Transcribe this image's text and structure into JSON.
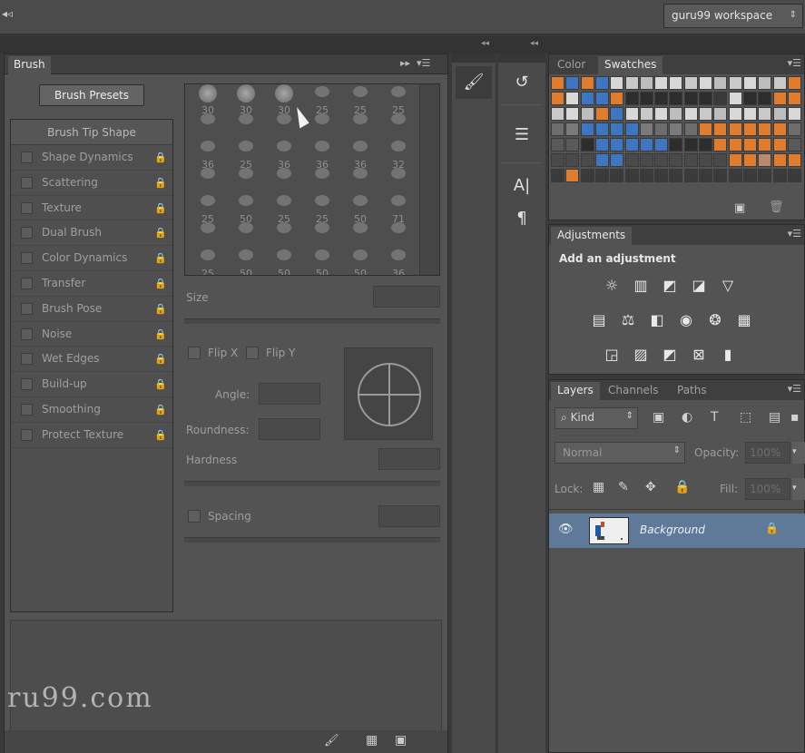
{
  "topbar": {
    "workspace_label": "guru99 workspace"
  },
  "brush": {
    "tab_label": "Brush",
    "presets_button": "Brush Presets",
    "tip_header": "Brush Tip Shape",
    "options": [
      "Shape Dynamics",
      "Scattering",
      "Texture",
      "Dual Brush",
      "Color Dynamics",
      "Transfer",
      "Brush Pose",
      "Noise",
      "Wet Edges",
      "Build-up",
      "Smoothing",
      "Protect Texture"
    ],
    "tip_sizes": [
      [
        "30",
        "30",
        "30",
        "25",
        "25",
        "25"
      ],
      [
        "",
        "",
        "",
        "",
        "",
        ""
      ],
      [
        "36",
        "25",
        "36",
        "36",
        "36",
        "32"
      ],
      [
        "",
        "",
        "",
        "",
        "",
        ""
      ],
      [
        "25",
        "50",
        "25",
        "25",
        "50",
        "71"
      ],
      [
        "",
        "",
        "",
        "",
        "",
        ""
      ],
      [
        "25",
        "50",
        "50",
        "50",
        "50",
        "36"
      ]
    ],
    "size_label": "Size",
    "flip_x_label": "Flip X",
    "flip_y_label": "Flip Y",
    "angle_label": "Angle:",
    "roundness_label": "Roundness:",
    "hardness_label": "Hardness",
    "spacing_label": "Spacing"
  },
  "watermark": "ru99.com",
  "swatches": {
    "tabs": [
      "Color",
      "Swatches"
    ],
    "colors": [
      [
        "#e07c2e",
        "#3f76c4",
        "#e07c2e",
        "#3f76c4",
        "#d8d8d8",
        "#c9c9c9",
        "#bdbdbd",
        "#d8d8d8",
        "#d8d8d8",
        "#c9c9c9",
        "#d8d8d8",
        "#bdbdbd",
        "#c9c9c9",
        "#d8d8d8",
        "#bdbdbd",
        "#c9c9c9",
        "#e07c2e"
      ],
      [
        "#e07c2e",
        "#d8d8d8",
        "#3f76c4",
        "#3f76c4",
        "#e07c2e",
        "#2d2d2d",
        "#2d2d2d",
        "#2d2d2d",
        "#2d2d2d",
        "#2d2d2d",
        "#2d2d2d",
        "#3a3a3a",
        "#d8d8d8",
        "#2d2d2d",
        "#2d2d2d",
        "#e07c2e",
        "#e07c2e"
      ],
      [
        "#c9c9c9",
        "#d8d8d8",
        "#bdbdbd",
        "#e07c2e",
        "#3f76c4",
        "#d8d8d8",
        "#c9c9c9",
        "#d8d8d8",
        "#bdbdbd",
        "#d8d8d8",
        "#c9c9c9",
        "#bdbdbd",
        "#d8d8d8",
        "#d8d8d8",
        "#c9c9c9",
        "#bdbdbd",
        "#d8d8d8"
      ],
      [
        "#6d6d6d",
        "#7a7a7a",
        "#3f76c4",
        "#3f76c4",
        "#3f76c4",
        "#3f76c4",
        "#7a7a7a",
        "#6d6d6d",
        "#7a7a7a",
        "#6d6d6d",
        "#e07c2e",
        "#e07c2e",
        "#e07c2e",
        "#e07c2e",
        "#e07c2e",
        "#e07c2e",
        "#6d6d6d"
      ],
      [
        "#5a5a5a",
        "#5a5a5a",
        "#2d2d2d",
        "#3f76c4",
        "#3f76c4",
        "#3f76c4",
        "#3f76c4",
        "#3f76c4",
        "#2d2d2d",
        "#2d2d2d",
        "#2d2d2d",
        "#e07c2e",
        "#e07c2e",
        "#e07c2e",
        "#e07c2e",
        "#e07c2e",
        "#5a5a5a"
      ],
      [
        "#4a4a4a",
        "#4a4a4a",
        "#4a4a4a",
        "#3f76c4",
        "#3f76c4",
        "#4a4a4a",
        "#4a4a4a",
        "#4a4a4a",
        "#4a4a4a",
        "#4a4a4a",
        "#4a4a4a",
        "#4a4a4a",
        "#e07c2e",
        "#e07c2e",
        "#b98a6e",
        "#e07c2e",
        "#e07c2e"
      ],
      [
        "#3a3a3a",
        "#e07c2e",
        "#3a3a3a",
        "#3a3a3a",
        "#3a3a3a",
        "#3a3a3a",
        "#3a3a3a",
        "#3a3a3a",
        "#3a3a3a",
        "#3a3a3a",
        "#3a3a3a",
        "#3a3a3a",
        "#3a3a3a",
        "#3a3a3a",
        "#3a3a3a",
        "#3a3a3a",
        "#3a3a3a"
      ]
    ]
  },
  "adjustments": {
    "tab_label": "Adjustments",
    "heading": "Add an adjustment",
    "icons_row1": [
      "brightness-icon",
      "levels-icon",
      "curves-icon",
      "exposure-icon",
      "vibrance-icon"
    ],
    "icons_row2": [
      "hue-saturation-icon",
      "color-balance-icon",
      "black-white-icon",
      "photo-filter-icon",
      "channel-mixer-icon",
      "color-lookup-icon"
    ],
    "icons_row3": [
      "invert-icon",
      "posterize-icon",
      "threshold-icon",
      "selective-color-icon",
      "gradient-map-icon"
    ]
  },
  "layers": {
    "tabs": [
      "Layers",
      "Channels",
      "Paths"
    ],
    "filter_label": "Kind",
    "blend_mode": "Normal",
    "opacity_label": "Opacity:",
    "opacity_value": "100%",
    "lock_label": "Lock:",
    "fill_label": "Fill:",
    "fill_value": "100%",
    "layer_name": "Background"
  }
}
